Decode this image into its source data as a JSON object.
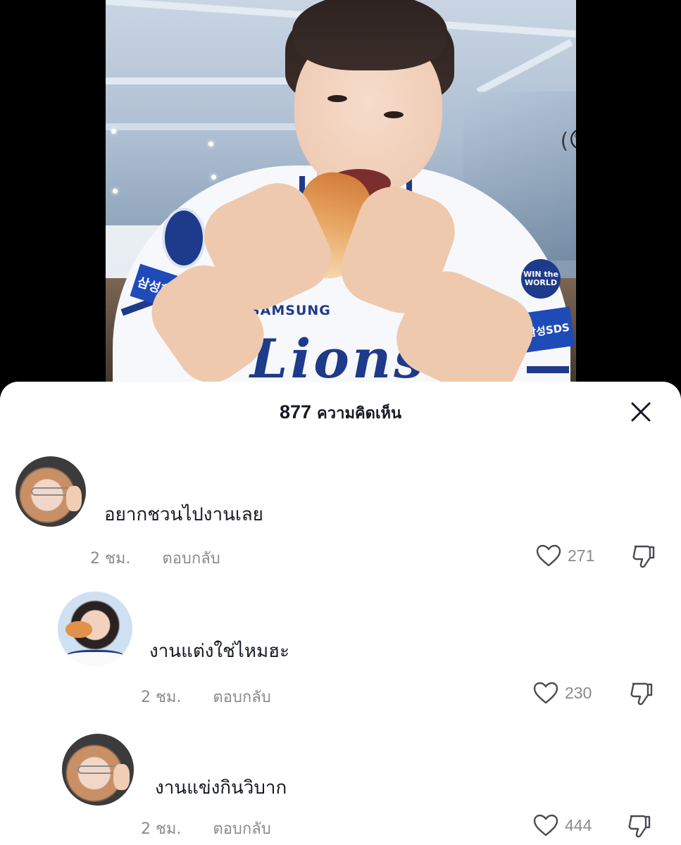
{
  "sheet": {
    "comment_count": "877",
    "comment_label": "ความคิดเห็น"
  },
  "video": {
    "reaction_emoji": "😲",
    "jersey_brand": "SAMSUNG",
    "jersey_team": "Lions",
    "patch_left": "삼성화재",
    "patch_right_top": "WIN the WORLD",
    "patch_right_bottom": "삼성SDS"
  },
  "comments": [
    {
      "text": "อยากชวนไปงานเลย",
      "time": "2 ชม.",
      "reply_label": "ตอบกลับ",
      "likes": "271",
      "avatar": "avatar-glasses-peace"
    },
    {
      "text": "งานแต่งใช่ไหมฮะ",
      "time": "2 ชม.",
      "reply_label": "ตอบกลับ",
      "likes": "230",
      "avatar": "avatar-eating"
    },
    {
      "text": "งานแข่งกินวิบาก",
      "time": "2 ชม.",
      "reply_label": "ตอบกลับ",
      "likes": "444",
      "avatar": "avatar-glasses-peace"
    }
  ],
  "icons": {
    "close": "close-icon",
    "like": "heart-icon",
    "dislike": "thumbs-down-icon"
  },
  "colors": {
    "text_primary": "#161823",
    "text_secondary": "#8a8b91",
    "sheet_bg": "#ffffff",
    "page_bg": "#000000"
  }
}
